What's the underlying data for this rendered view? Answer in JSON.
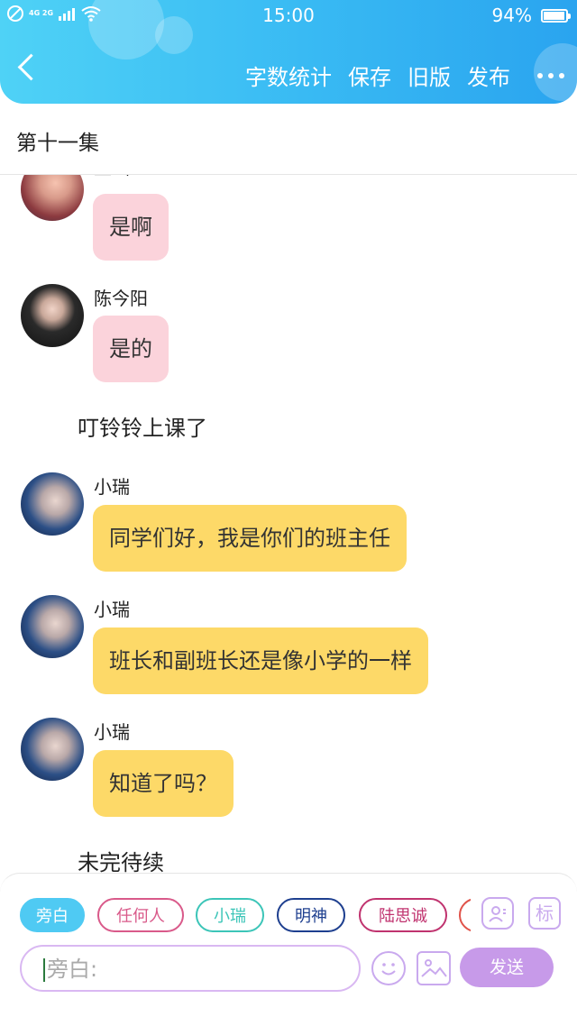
{
  "status_bar": {
    "time": "15:00",
    "battery": "94%",
    "network": "4G 2G"
  },
  "header": {
    "actions": [
      "字数统计",
      "保存",
      "旧版",
      "发布"
    ]
  },
  "episode_title": "第十一集",
  "messages": [
    {
      "type": "bubble",
      "sender": "董瑶",
      "text": "是啊",
      "color": "#fbd3db"
    },
    {
      "type": "bubble",
      "sender": "陈今阳",
      "text": "是的",
      "color": "#fbd3db"
    },
    {
      "type": "narration",
      "text": "叮铃铃上课了"
    },
    {
      "type": "bubble",
      "sender": "小瑞",
      "text": "同学们好，我是你们的班主任",
      "color": "#fdd968"
    },
    {
      "type": "bubble",
      "sender": "小瑞",
      "text": "班长和副班长还是像小学的一样",
      "color": "#fdd968"
    },
    {
      "type": "bubble",
      "sender": "小瑞",
      "text": "知道了吗？",
      "color": "#fdd968"
    },
    {
      "type": "narration",
      "text": "未完待续"
    }
  ],
  "roles": [
    {
      "label": "旁白",
      "color": "#4fcaf3",
      "active": true
    },
    {
      "label": "任何人",
      "color": "#d95a8a"
    },
    {
      "label": "小瑞",
      "color": "#3cc5b8"
    },
    {
      "label": "明神",
      "color": "#1e3f8f"
    },
    {
      "label": "陆思诚",
      "color": "#c0336f"
    }
  ],
  "tools": {
    "role_icon": "person-card-icon",
    "tag_label": "标"
  },
  "composer": {
    "placeholder": "旁白:",
    "send_label": "发送"
  }
}
